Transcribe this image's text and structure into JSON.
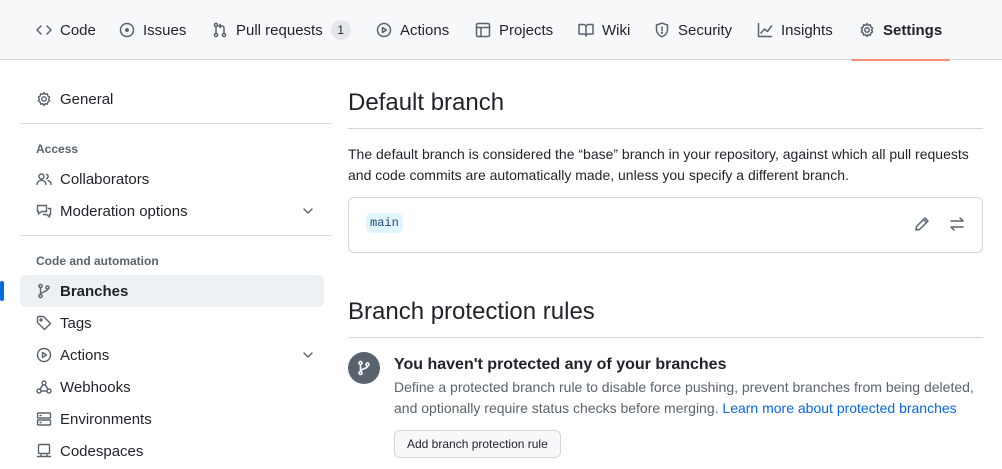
{
  "repo_nav": {
    "tabs": [
      {
        "label": "Code",
        "icon": "code-icon"
      },
      {
        "label": "Issues",
        "icon": "issue-opened-icon"
      },
      {
        "label": "Pull requests",
        "icon": "git-pull-request-icon",
        "count": "1"
      },
      {
        "label": "Actions",
        "icon": "play-icon"
      },
      {
        "label": "Projects",
        "icon": "table-icon"
      },
      {
        "label": "Wiki",
        "icon": "book-icon"
      },
      {
        "label": "Security",
        "icon": "shield-icon"
      },
      {
        "label": "Insights",
        "icon": "graph-icon"
      },
      {
        "label": "Settings",
        "icon": "gear-icon",
        "active": true
      }
    ]
  },
  "sidebar": {
    "general": "General",
    "access_heading": "Access",
    "collaborators": "Collaborators",
    "moderation": "Moderation options",
    "code_heading": "Code and automation",
    "branches": "Branches",
    "tags": "Tags",
    "actions": "Actions",
    "webhooks": "Webhooks",
    "environments": "Environments",
    "codespaces": "Codespaces"
  },
  "default_branch": {
    "title": "Default branch",
    "description": "The default branch is considered the “base” branch in your repository, against which all pull requests and code commits are automatically made, unless you specify a different branch.",
    "branch_name": "main"
  },
  "protection": {
    "title": "Branch protection rules",
    "empty_title": "You haven't protected any of your branches",
    "empty_desc": "Define a protected branch rule to disable force pushing, prevent branches from being deleted, and optionally require status checks before merging.",
    "learn_more": "Learn more about protected branches",
    "add_button": "Add branch protection rule"
  },
  "colors": {
    "accent": "#0969da",
    "active_underline": "#fd8c73"
  }
}
